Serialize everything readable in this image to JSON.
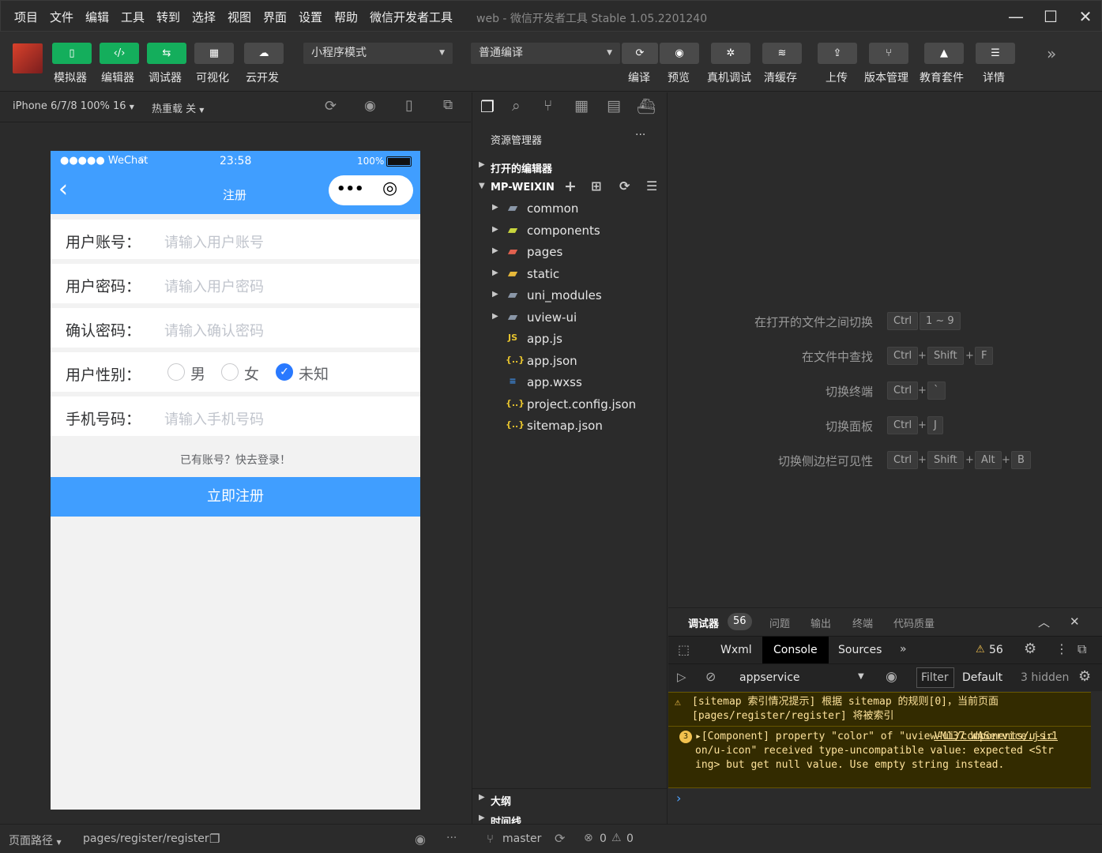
{
  "menubar": {
    "items": [
      "项目",
      "文件",
      "编辑",
      "工具",
      "转到",
      "选择",
      "视图",
      "界面",
      "设置",
      "帮助",
      "微信开发者工具"
    ],
    "window_title": "web - 微信开发者工具 Stable 1.05.2201240",
    "minimize": "—",
    "maximize": "☐",
    "close": "✕"
  },
  "toolbar": {
    "left_buttons": [
      {
        "label": "模拟器",
        "icon": "phone-icon",
        "glyph": "▯"
      },
      {
        "label": "编辑器",
        "icon": "code-icon",
        "glyph": "‹/›"
      },
      {
        "label": "调试器",
        "icon": "debug-icon",
        "glyph": "⇆"
      },
      {
        "label": "可视化",
        "icon": "layout-icon",
        "glyph": "▦"
      },
      {
        "label": "云开发",
        "icon": "cloud-icon",
        "glyph": "☁"
      }
    ],
    "mode_select": "小程序模式",
    "compile_select": "普通编译",
    "right_buttons": [
      {
        "label": "编译",
        "icon": "refresh-icon",
        "glyph": "⟳"
      },
      {
        "label": "预览",
        "icon": "eye-icon",
        "glyph": "◉"
      },
      {
        "label": "真机调试",
        "icon": "bug-icon",
        "glyph": "✲"
      },
      {
        "label": "清缓存",
        "icon": "layers-icon",
        "glyph": "≋"
      },
      {
        "label": "上传",
        "icon": "upload-icon",
        "glyph": "⇪"
      },
      {
        "label": "版本管理",
        "icon": "branch-icon",
        "glyph": "⑂"
      },
      {
        "label": "教育套件",
        "icon": "graduation-icon",
        "glyph": "▲"
      },
      {
        "label": "详情",
        "icon": "menu-icon",
        "glyph": "☰"
      }
    ],
    "more": "»"
  },
  "simulator": {
    "device": "iPhone 6/7/8 100% 16",
    "hot_reload": "热重载 关",
    "phone": {
      "carrier": "●●●●● WeChat",
      "time": "23:58",
      "battery": "100%",
      "nav_title": "注册",
      "back": "‹",
      "capsule_more": "•••",
      "capsule_close": "◎",
      "fields": [
        {
          "label": "用户账号：",
          "placeholder": "请输入用户账号"
        },
        {
          "label": "用户密码：",
          "placeholder": "请输入用户密码"
        },
        {
          "label": "确认密码：",
          "placeholder": "请输入确认密码"
        }
      ],
      "gender": {
        "label": "用户性别：",
        "options": [
          "男",
          "女",
          "未知"
        ],
        "selected": "未知",
        "check": "✓"
      },
      "phone_field": {
        "label": "手机号码：",
        "placeholder": "请输入手机号码"
      },
      "login_hint": "已有账号？快去登录！",
      "submit": "立即注册"
    }
  },
  "explorer": {
    "title": "资源管理器",
    "more": "···",
    "open_editors": "打开的编辑器",
    "project": "MP-WEIXIN",
    "items": [
      {
        "name": "common",
        "type": "folder",
        "glyph": "▰",
        "color": "#8a97a8"
      },
      {
        "name": "components",
        "type": "folder",
        "glyph": "▰",
        "color": "#c9d63d"
      },
      {
        "name": "pages",
        "type": "folder",
        "glyph": "▰",
        "color": "#e2614f"
      },
      {
        "name": "static",
        "type": "folder",
        "glyph": "▰",
        "color": "#e6b83a"
      },
      {
        "name": "uni_modules",
        "type": "folder",
        "glyph": "▰",
        "color": "#8a97a8"
      },
      {
        "name": "uview-ui",
        "type": "folder",
        "glyph": "▰",
        "color": "#8a97a8"
      },
      {
        "name": "app.js",
        "type": "file",
        "glyph": "JS",
        "color": "#e6c32e"
      },
      {
        "name": "app.json",
        "type": "file",
        "glyph": "{..}",
        "color": "#e6c32e"
      },
      {
        "name": "app.wxss",
        "type": "file",
        "glyph": "≡",
        "color": "#3e8ee6"
      },
      {
        "name": "project.config.json",
        "type": "file",
        "glyph": "{..}",
        "color": "#e6c32e"
      },
      {
        "name": "sitemap.json",
        "type": "file",
        "glyph": "{..}",
        "color": "#e6c32e"
      }
    ],
    "outline": "大纲",
    "timeline": "时间线"
  },
  "shortcuts": [
    {
      "label": "在打开的文件之间切换",
      "keys": [
        "Ctrl",
        "1 ~ 9"
      ]
    },
    {
      "label": "在文件中查找",
      "keys": [
        "Ctrl",
        "Shift",
        "F"
      ]
    },
    {
      "label": "切换终端",
      "keys": [
        "Ctrl",
        "`"
      ]
    },
    {
      "label": "切换面板",
      "keys": [
        "Ctrl",
        "J"
      ]
    },
    {
      "label": "切换侧边栏可见性",
      "keys": [
        "Ctrl",
        "Shift",
        "Alt",
        "B"
      ]
    }
  ],
  "debugger": {
    "tabs": [
      "调试器",
      "问题",
      "输出",
      "终端",
      "代码质量"
    ],
    "badge": "56",
    "devtools_tabs": [
      "Wxml",
      "Console",
      "Sources"
    ],
    "active_tab": "Console",
    "warn_count": "56",
    "context": "appservice",
    "filter": "Filter",
    "level": "Default",
    "hidden": "3 hidden",
    "messages": [
      {
        "text": "[sitemap 索引情况提示] 根据 sitemap 的规则[0]，当前页面 [pages/register/register] 将被索引"
      },
      {
        "count": "3",
        "text": "▸[Component] property \"color\" of \"uview-ui/components/u-icon/u-icon\" received type-uncompatible value: expected <String> but get null value. Use empty string instead.",
        "source": "VM137 WAService.js:1"
      }
    ],
    "prompt": "›"
  },
  "statusbar": {
    "page_path_label": "页面路径",
    "page_path": "pages/register/register",
    "branch": "master",
    "errors": "0",
    "warnings": "0"
  }
}
